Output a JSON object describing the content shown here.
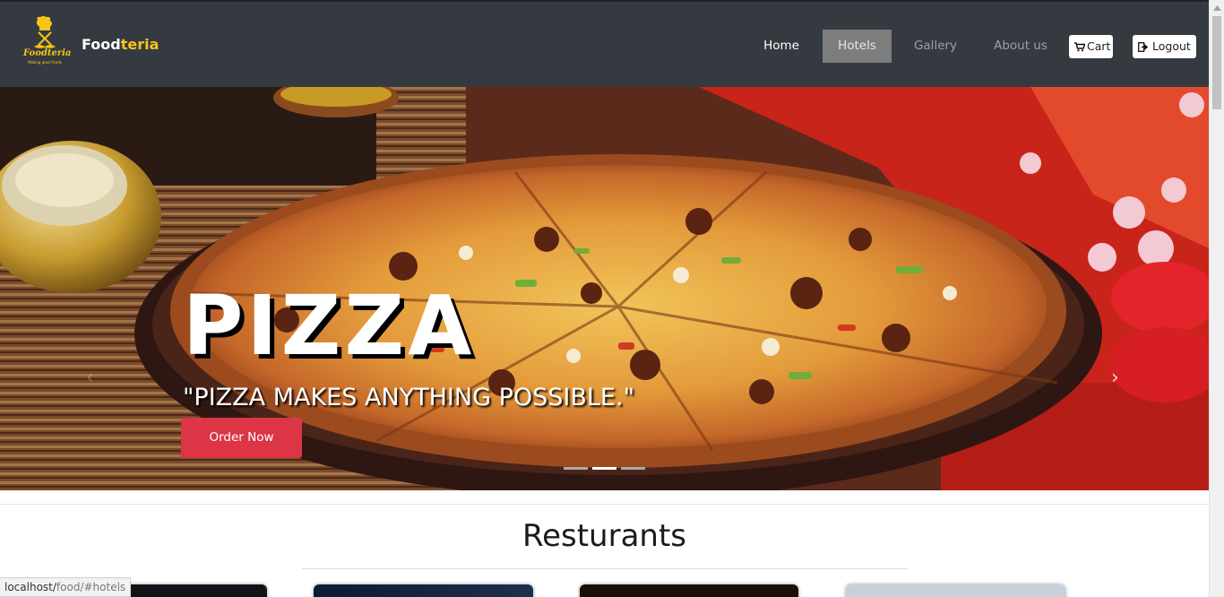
{
  "navbar": {
    "brand_prefix": "Food",
    "brand_suffix": "teria",
    "logo_text": "Foodteria",
    "logo_tagline": "Making good foods",
    "items": [
      {
        "label": "Home"
      },
      {
        "label": "Hotels"
      },
      {
        "label": "Gallery"
      },
      {
        "label": "About us"
      }
    ],
    "cart_label": "Cart",
    "logout_label": "Logout"
  },
  "hero": {
    "title": "PIZZA",
    "subtitle": "\"PIZZA MAKES ANYTHING POSSIBLE.\"",
    "order_label": "Order Now",
    "active_slide": 2,
    "slide_count": 3,
    "prev_symbol": "‹",
    "next_symbol": "›"
  },
  "section": {
    "title": "Resturants"
  },
  "status_bar": {
    "host": "localhost/",
    "path": "food/#hotels"
  },
  "colors": {
    "navbar_bg": "#343a40",
    "brand_accent": "#f5c518",
    "order_button": "#dc3545",
    "active_nav_bg": "#7d7d7d"
  }
}
